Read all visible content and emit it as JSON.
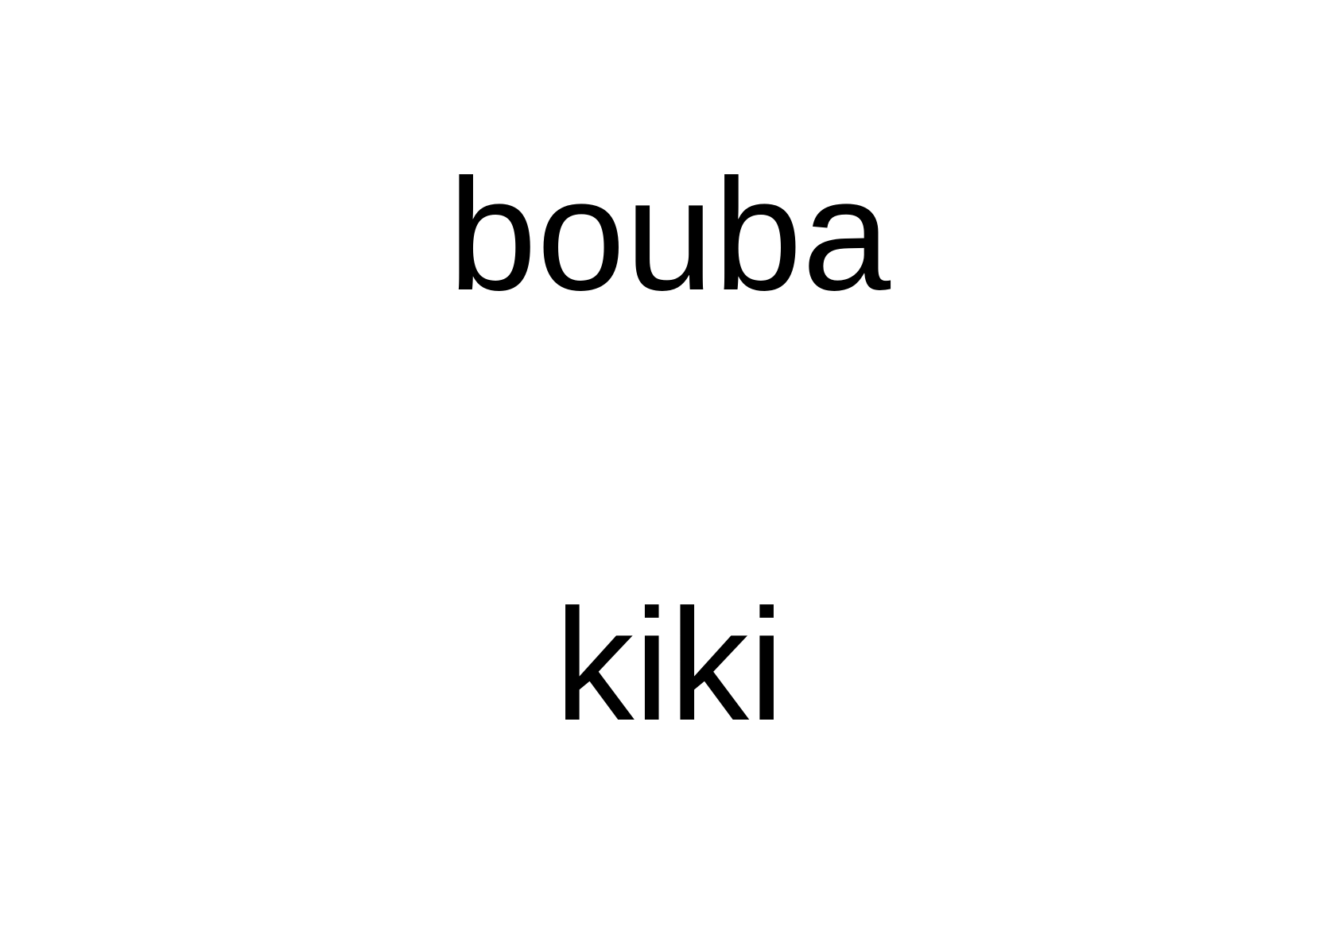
{
  "words": {
    "top": "bouba",
    "bottom": "kiki"
  },
  "colors": {
    "background": "#ffffff",
    "text": "#000000"
  }
}
